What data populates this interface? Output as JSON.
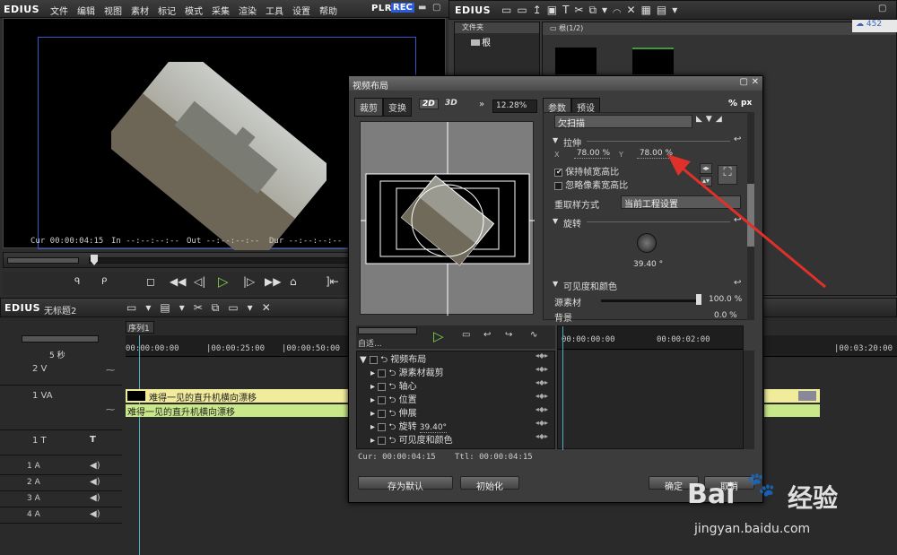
{
  "app": {
    "logo": "EDIUS",
    "plr": "PLR",
    "rec": "REC"
  },
  "menu": [
    "文件",
    "编辑",
    "视图",
    "素材",
    "标记",
    "模式",
    "采集",
    "渲染",
    "工具",
    "设置",
    "帮助"
  ],
  "preview": {
    "cur": "Cur 00:00:04:15",
    "in": "In --:--:--:--",
    "out": "Out --:--:--:--",
    "dur": "Dur --:--:--:--"
  },
  "bin": {
    "logo": "EDIUS",
    "folder_label": "文件夹",
    "root": "根",
    "bin_name": "根(1/2)",
    "count": "452"
  },
  "dialog": {
    "title": "视频布局",
    "tabs": [
      "裁剪",
      "变换"
    ],
    "btn_2d": "2D",
    "btn_3d": "3D",
    "zoom": "12.28%",
    "param_tabs": [
      "参数",
      "预设"
    ],
    "percent": "%",
    "px": "px",
    "scan_mode": "欠扫描",
    "stretch_label": "拉伸",
    "x_label": "X",
    "x_value": "78.00 %",
    "y_label": "Y",
    "y_value": "78.00 %",
    "keep_aspect": "保持帧宽高比",
    "ignore_pixel": "忽略像素宽高比",
    "resample_label": "重取样方式",
    "resample_value": "当前工程设置",
    "rotation_label": "旋转",
    "rotation_value": "39.40 °",
    "visibility_label": "可见度和颜色",
    "source_label": "源素材",
    "source_value": "100.0 %",
    "bg_label": "背景",
    "bg_value": "0.0 %",
    "auto_label": "自适...",
    "tracks": [
      {
        "label": "视频布局",
        "value": ""
      },
      {
        "label": "源素材裁剪",
        "value": ""
      },
      {
        "label": "轴心",
        "value": ""
      },
      {
        "label": "位置",
        "value": ""
      },
      {
        "label": "伸展",
        "value": ""
      },
      {
        "label": "旋转",
        "value": "39.40°"
      },
      {
        "label": "可见度和颜色",
        "value": ""
      }
    ],
    "cur": "Cur: 00:00:04:15",
    "ttl": "Ttl: 00:00:04:15",
    "kf_ruler": [
      "00:00:00:00",
      "00:00:02:00",
      "00:00:04:00"
    ],
    "save_default": "存为默认",
    "initialize": "初始化",
    "ok": "确定",
    "cancel": "取消"
  },
  "timeline": {
    "logo": "EDIUS",
    "project": "无标题2",
    "sequence_tab": "序列1",
    "scale": "5 秒",
    "ruler": [
      "00:00:00:00",
      "|00:00:25:00",
      "|00:00:50:00",
      "|00:03:20:00"
    ],
    "tracks": [
      {
        "name": "2 V"
      },
      {
        "name": "1 VA"
      },
      {
        "name": "1 T"
      },
      {
        "name": "1 A"
      },
      {
        "name": "2 A"
      },
      {
        "name": "3 A"
      },
      {
        "name": "4 A"
      }
    ],
    "clip_name": "难得一见的直升机横向漂移",
    "clip_name_audio": "难得一见的直升机横向漂移"
  },
  "watermark": {
    "brand": "Bai",
    "brand2": "经验",
    "url": "jingyan.baidu.com"
  }
}
